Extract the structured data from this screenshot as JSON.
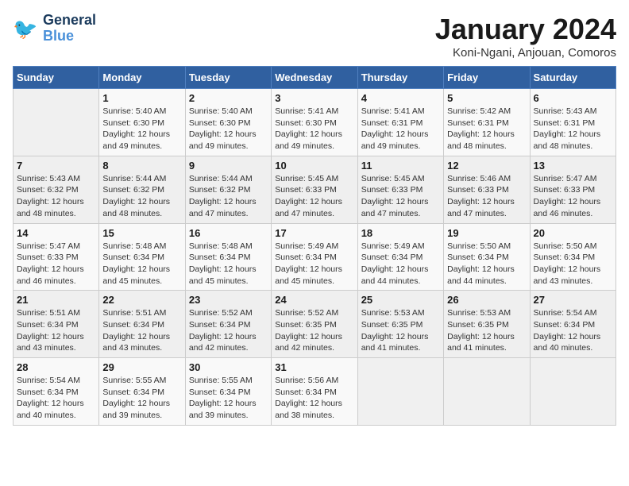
{
  "header": {
    "logo_general": "General",
    "logo_blue": "Blue",
    "month_title": "January 2024",
    "location": "Koni-Ngani, Anjouan, Comoros"
  },
  "days_of_week": [
    "Sunday",
    "Monday",
    "Tuesday",
    "Wednesday",
    "Thursday",
    "Friday",
    "Saturday"
  ],
  "weeks": [
    [
      {
        "day": "",
        "info": ""
      },
      {
        "day": "1",
        "info": "Sunrise: 5:40 AM\nSunset: 6:30 PM\nDaylight: 12 hours\nand 49 minutes."
      },
      {
        "day": "2",
        "info": "Sunrise: 5:40 AM\nSunset: 6:30 PM\nDaylight: 12 hours\nand 49 minutes."
      },
      {
        "day": "3",
        "info": "Sunrise: 5:41 AM\nSunset: 6:30 PM\nDaylight: 12 hours\nand 49 minutes."
      },
      {
        "day": "4",
        "info": "Sunrise: 5:41 AM\nSunset: 6:31 PM\nDaylight: 12 hours\nand 49 minutes."
      },
      {
        "day": "5",
        "info": "Sunrise: 5:42 AM\nSunset: 6:31 PM\nDaylight: 12 hours\nand 48 minutes."
      },
      {
        "day": "6",
        "info": "Sunrise: 5:43 AM\nSunset: 6:31 PM\nDaylight: 12 hours\nand 48 minutes."
      }
    ],
    [
      {
        "day": "7",
        "info": "Sunrise: 5:43 AM\nSunset: 6:32 PM\nDaylight: 12 hours\nand 48 minutes."
      },
      {
        "day": "8",
        "info": "Sunrise: 5:44 AM\nSunset: 6:32 PM\nDaylight: 12 hours\nand 48 minutes."
      },
      {
        "day": "9",
        "info": "Sunrise: 5:44 AM\nSunset: 6:32 PM\nDaylight: 12 hours\nand 47 minutes."
      },
      {
        "day": "10",
        "info": "Sunrise: 5:45 AM\nSunset: 6:33 PM\nDaylight: 12 hours\nand 47 minutes."
      },
      {
        "day": "11",
        "info": "Sunrise: 5:45 AM\nSunset: 6:33 PM\nDaylight: 12 hours\nand 47 minutes."
      },
      {
        "day": "12",
        "info": "Sunrise: 5:46 AM\nSunset: 6:33 PM\nDaylight: 12 hours\nand 47 minutes."
      },
      {
        "day": "13",
        "info": "Sunrise: 5:47 AM\nSunset: 6:33 PM\nDaylight: 12 hours\nand 46 minutes."
      }
    ],
    [
      {
        "day": "14",
        "info": "Sunrise: 5:47 AM\nSunset: 6:33 PM\nDaylight: 12 hours\nand 46 minutes."
      },
      {
        "day": "15",
        "info": "Sunrise: 5:48 AM\nSunset: 6:34 PM\nDaylight: 12 hours\nand 45 minutes."
      },
      {
        "day": "16",
        "info": "Sunrise: 5:48 AM\nSunset: 6:34 PM\nDaylight: 12 hours\nand 45 minutes."
      },
      {
        "day": "17",
        "info": "Sunrise: 5:49 AM\nSunset: 6:34 PM\nDaylight: 12 hours\nand 45 minutes."
      },
      {
        "day": "18",
        "info": "Sunrise: 5:49 AM\nSunset: 6:34 PM\nDaylight: 12 hours\nand 44 minutes."
      },
      {
        "day": "19",
        "info": "Sunrise: 5:50 AM\nSunset: 6:34 PM\nDaylight: 12 hours\nand 44 minutes."
      },
      {
        "day": "20",
        "info": "Sunrise: 5:50 AM\nSunset: 6:34 PM\nDaylight: 12 hours\nand 43 minutes."
      }
    ],
    [
      {
        "day": "21",
        "info": "Sunrise: 5:51 AM\nSunset: 6:34 PM\nDaylight: 12 hours\nand 43 minutes."
      },
      {
        "day": "22",
        "info": "Sunrise: 5:51 AM\nSunset: 6:34 PM\nDaylight: 12 hours\nand 43 minutes."
      },
      {
        "day": "23",
        "info": "Sunrise: 5:52 AM\nSunset: 6:34 PM\nDaylight: 12 hours\nand 42 minutes."
      },
      {
        "day": "24",
        "info": "Sunrise: 5:52 AM\nSunset: 6:35 PM\nDaylight: 12 hours\nand 42 minutes."
      },
      {
        "day": "25",
        "info": "Sunrise: 5:53 AM\nSunset: 6:35 PM\nDaylight: 12 hours\nand 41 minutes."
      },
      {
        "day": "26",
        "info": "Sunrise: 5:53 AM\nSunset: 6:35 PM\nDaylight: 12 hours\nand 41 minutes."
      },
      {
        "day": "27",
        "info": "Sunrise: 5:54 AM\nSunset: 6:34 PM\nDaylight: 12 hours\nand 40 minutes."
      }
    ],
    [
      {
        "day": "28",
        "info": "Sunrise: 5:54 AM\nSunset: 6:34 PM\nDaylight: 12 hours\nand 40 minutes."
      },
      {
        "day": "29",
        "info": "Sunrise: 5:55 AM\nSunset: 6:34 PM\nDaylight: 12 hours\nand 39 minutes."
      },
      {
        "day": "30",
        "info": "Sunrise: 5:55 AM\nSunset: 6:34 PM\nDaylight: 12 hours\nand 39 minutes."
      },
      {
        "day": "31",
        "info": "Sunrise: 5:56 AM\nSunset: 6:34 PM\nDaylight: 12 hours\nand 38 minutes."
      },
      {
        "day": "",
        "info": ""
      },
      {
        "day": "",
        "info": ""
      },
      {
        "day": "",
        "info": ""
      }
    ]
  ]
}
